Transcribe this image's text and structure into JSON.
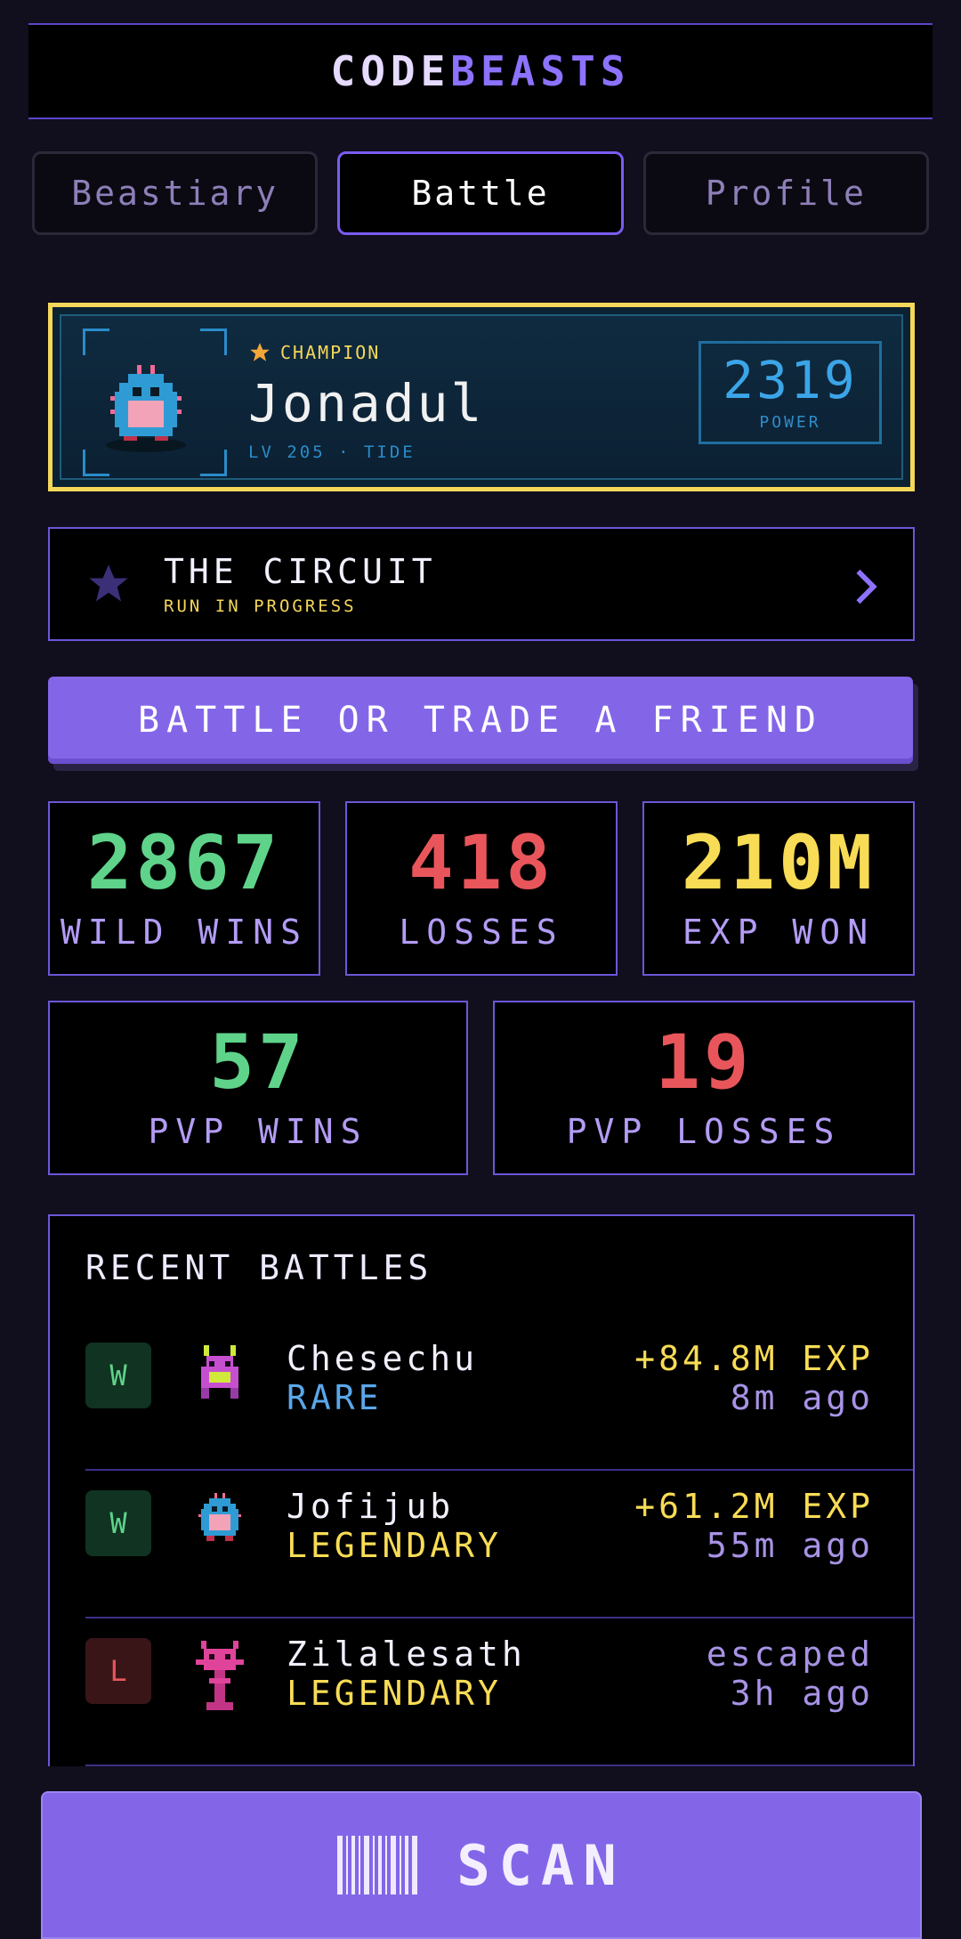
{
  "header": {
    "logo_part1": "CODE",
    "logo_part2": "BEASTS"
  },
  "tabs": [
    {
      "label": "Beastiary",
      "active": false
    },
    {
      "label": "Battle",
      "active": true
    },
    {
      "label": "Profile",
      "active": false
    }
  ],
  "champion": {
    "tag": "CHAMPION",
    "name": "Jonadul",
    "subtitle": "LV 205 · TIDE",
    "power_value": "2319",
    "power_label": "POWER"
  },
  "circuit": {
    "title": "THE CIRCUIT",
    "subtitle": "RUN IN PROGRESS"
  },
  "battle_button": "BATTLE OR TRADE A FRIEND",
  "stats": {
    "wild_wins": {
      "value": "2867",
      "label": "WILD WINS"
    },
    "losses": {
      "value": "418",
      "label": "LOSSES"
    },
    "exp_won": {
      "value": "210M",
      "label": "EXP WON"
    },
    "pvp_wins": {
      "value": "57",
      "label": "PVP WINS"
    },
    "pvp_losses": {
      "value": "19",
      "label": "PVP LOSSES"
    }
  },
  "recent": {
    "title": "RECENT BATTLES",
    "rows": [
      {
        "result_badge": "W",
        "name": "Chesechu",
        "rarity": "RARE",
        "result": "+84.8M EXP",
        "time": "8m ago"
      },
      {
        "result_badge": "W",
        "name": "Jofijub",
        "rarity": "LEGENDARY",
        "result": "+61.2M EXP",
        "time": "55m ago"
      },
      {
        "result_badge": "L",
        "name": "Zilalesath",
        "rarity": "LEGENDARY",
        "result": "escaped",
        "time": "3h ago"
      }
    ]
  },
  "scan_button": "SCAN",
  "colors": {
    "accent": "#8366e8",
    "gold": "#f5d75a",
    "win": "#5fd38a",
    "loss": "#e8565b",
    "rare": "#5aa7ea"
  }
}
